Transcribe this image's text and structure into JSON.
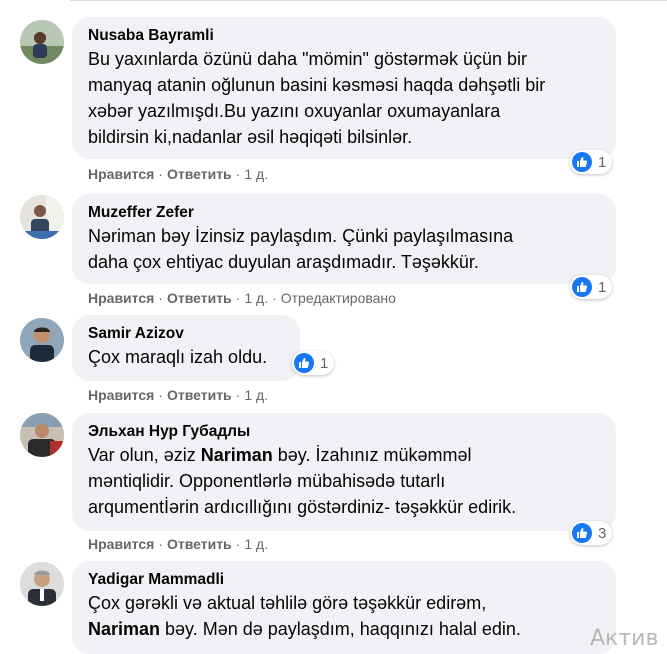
{
  "actions": {
    "like_label": "Нравится",
    "reply_label": "Ответить",
    "separator": "·",
    "edited_label": "Отредактировано"
  },
  "comments": [
    {
      "author": "Nusaba Bayramli",
      "lines": [
        "Bu yaxınlarda özünü daha \"mömin\" göstərmək üçün bir",
        "manyaq atanin oğlunun basini kəsməsi haqda dəhşətli bir",
        "xəbər yazılmışdı.Bu yazını oxuyanlar oxumayanlara",
        "bildirsin ki,nadanlar əsil həqiqəti bilsinlər."
      ],
      "reactions": "1",
      "time": "1 д."
    },
    {
      "author": "Muzeffer Zefer",
      "lines": [
        "Nəriman bəy İzinsiz paylaşdım. Çünki paylaşılmasına",
        "daha çox ehtiyac duyulan araşdımadır. Təşəkkür."
      ],
      "reactions": "1",
      "time": "1 д."
    },
    {
      "author": "Samir Azizov",
      "lines": [
        "Çox maraqlı izah oldu."
      ],
      "reactions": "1",
      "time": "1 д."
    },
    {
      "author": "Эльхан Нур Губадлы",
      "line1_prefix": "Var olun, əziz ",
      "line1_bold": "Nariman",
      "line1_suffix": " bəy. İzahınız mükəmməl",
      "lines": [
        "məntiqlidir. Opponentlərlə mübahisədə tutarlı",
        "arqumentİərin ardıcıllığını göstərdiniz- təşəkkür edirik."
      ],
      "reactions": "3",
      "time": "1 д."
    },
    {
      "author": "Yadigar Mammadli",
      "line1": "Çox gərəkli və aktual təhlilə görə təşəkkür edirəm,",
      "line2_bold": "Nariman",
      "line2_suffix": " bəy. Mən də paylaşdım, haqqınızı halal edin."
    }
  ],
  "watermark": "Актив",
  "colors": {
    "bubble": "#f0f2f5",
    "like_blue": "#1877f2",
    "meta_gray": "#65676b"
  }
}
